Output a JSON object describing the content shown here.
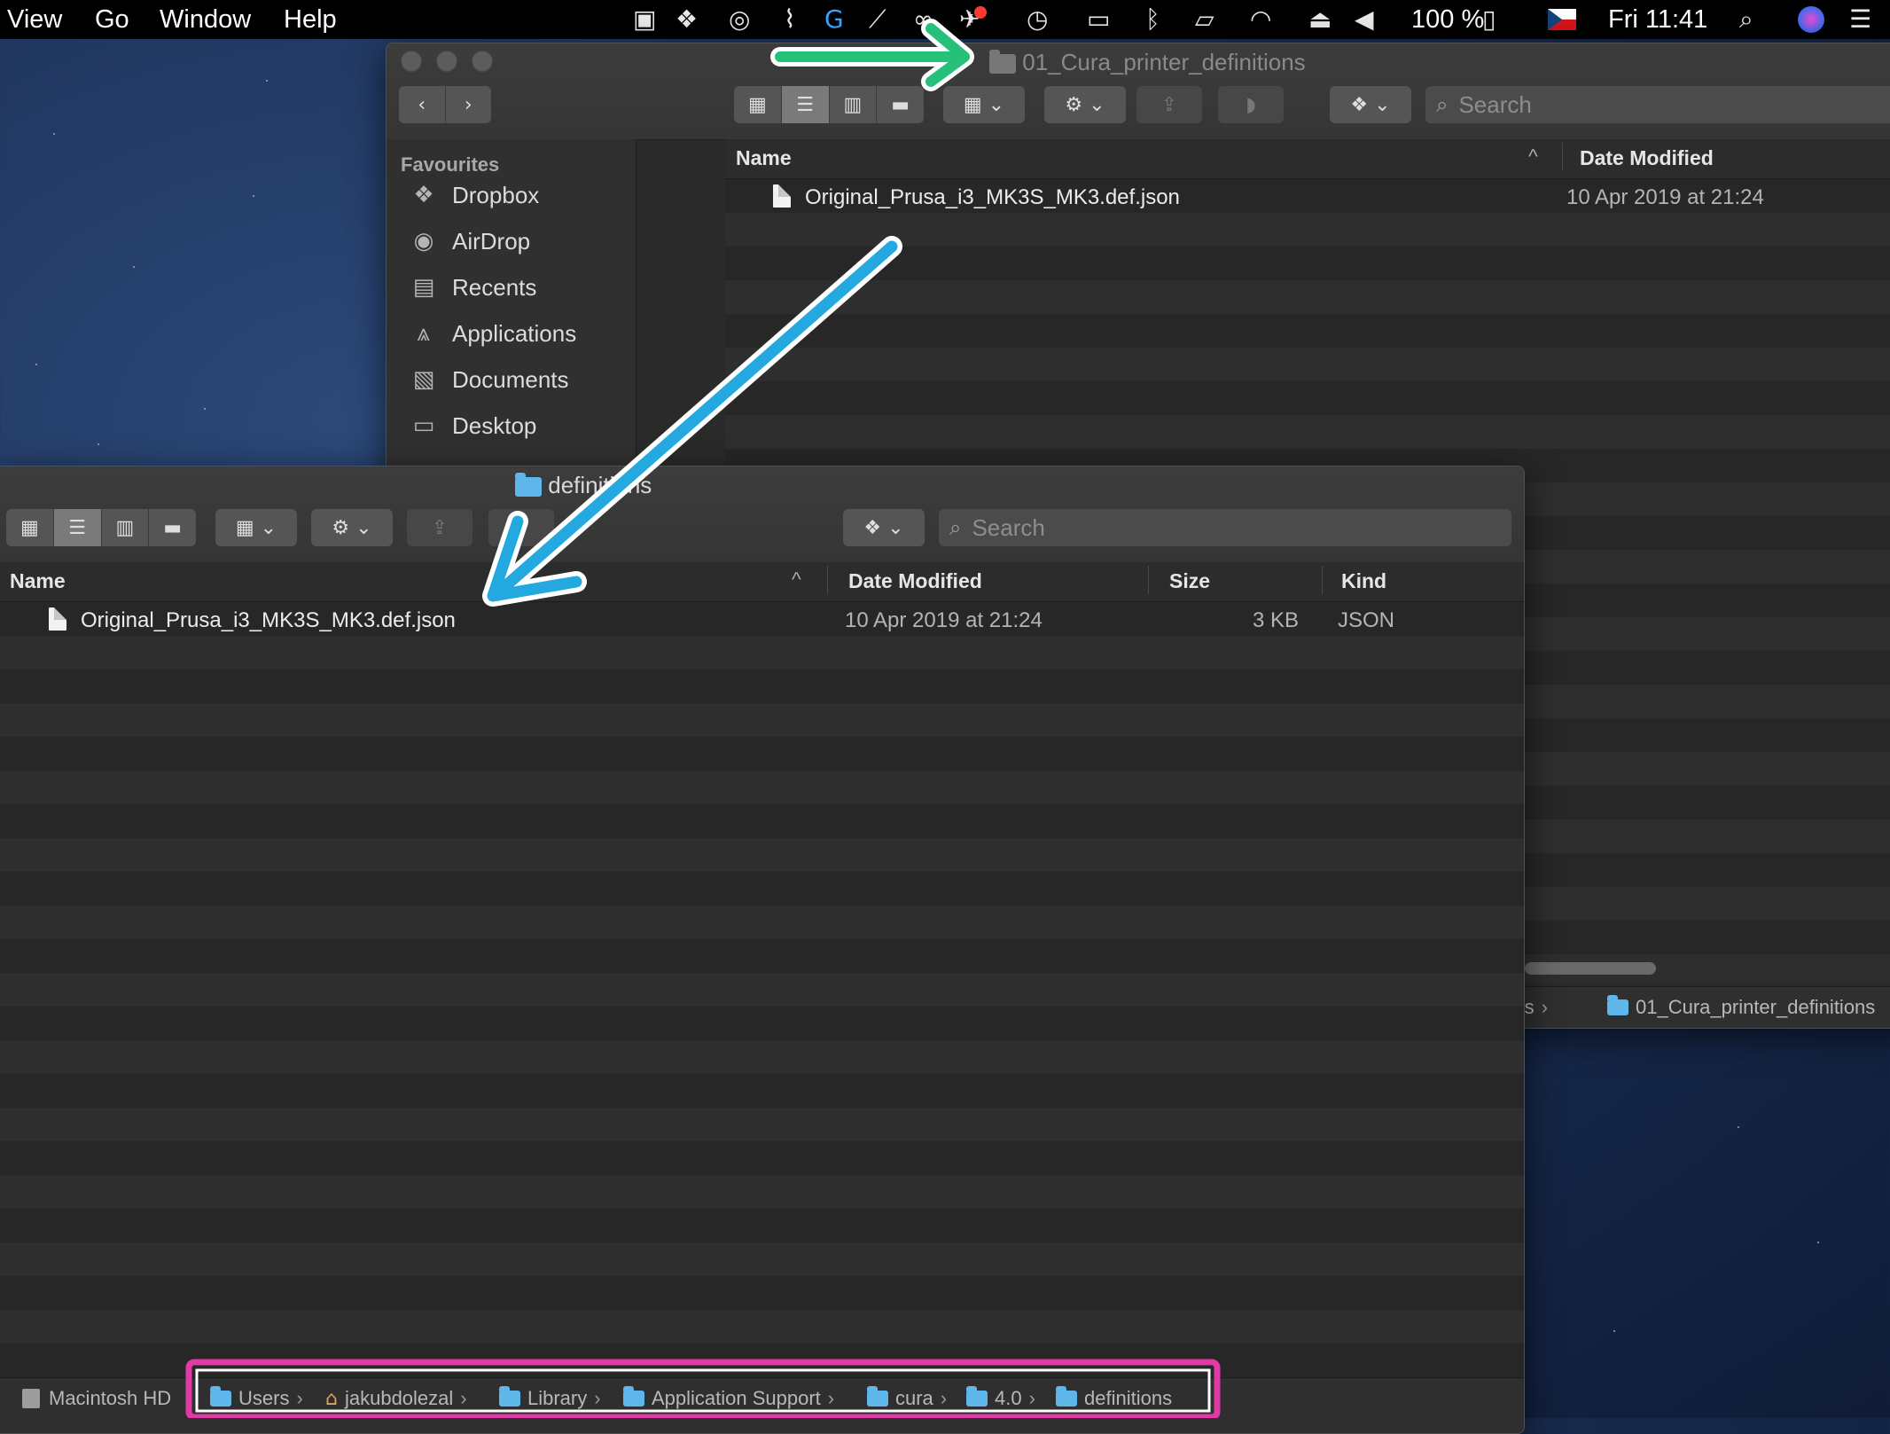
{
  "colors": {
    "green_arrow": "#25c07a",
    "blue_arrow": "#24a8e0",
    "pink_highlight": "#e03aa6",
    "folder_blue": "#5fb6ea"
  },
  "menubar": {
    "items": [
      "View",
      "Go",
      "Window",
      "Help"
    ],
    "status_icons": [
      "bookmark-icon",
      "dropbox-icon",
      "creative-cloud-icon",
      "paperclip-icon",
      "logitech-icon",
      "brush-icon",
      "glasses-icon",
      "bird-icon",
      "time-machine-icon",
      "battery-meter-icon",
      "bluetooth-icon",
      "airplay-icon",
      "wifi-icon",
      "eject-icon",
      "volume-icon"
    ],
    "battery": "100 %",
    "clock": "Fri 11:41"
  },
  "back_window": {
    "title": "01_Cura_printer_definitions",
    "sidebar_heading": "Favourites",
    "sidebar_items": [
      {
        "label": "Dropbox",
        "icon": "dropbox-icon"
      },
      {
        "label": "AirDrop",
        "icon": "airdrop-icon"
      },
      {
        "label": "Recents",
        "icon": "recents-icon"
      },
      {
        "label": "Applications",
        "icon": "applications-icon"
      },
      {
        "label": "Documents",
        "icon": "documents-icon"
      },
      {
        "label": "Desktop",
        "icon": "desktop-icon"
      }
    ],
    "search_placeholder": "Search",
    "columns": {
      "name": "Name",
      "date": "Date Modified"
    },
    "files": [
      {
        "name": "Original_Prusa_i3_MK3S_MK3.def.json",
        "date": "10 Apr 2019 at 21:24"
      }
    ],
    "path_partial": [
      "rofiles",
      "01_Cura_printer_definitions"
    ]
  },
  "front_window": {
    "title": "definitions",
    "search_placeholder": "Search",
    "columns": {
      "name": "Name",
      "date": "Date Modified",
      "size": "Size",
      "kind": "Kind"
    },
    "files": [
      {
        "name": "Original_Prusa_i3_MK3S_MK3.def.json",
        "date": "10 Apr 2019 at 21:24",
        "size": "3 KB",
        "kind": "JSON"
      }
    ],
    "path": [
      "Macintosh HD",
      "Users",
      "jakubdolezal",
      "Library",
      "Application Support",
      "cura",
      "4.0",
      "definitions"
    ]
  }
}
